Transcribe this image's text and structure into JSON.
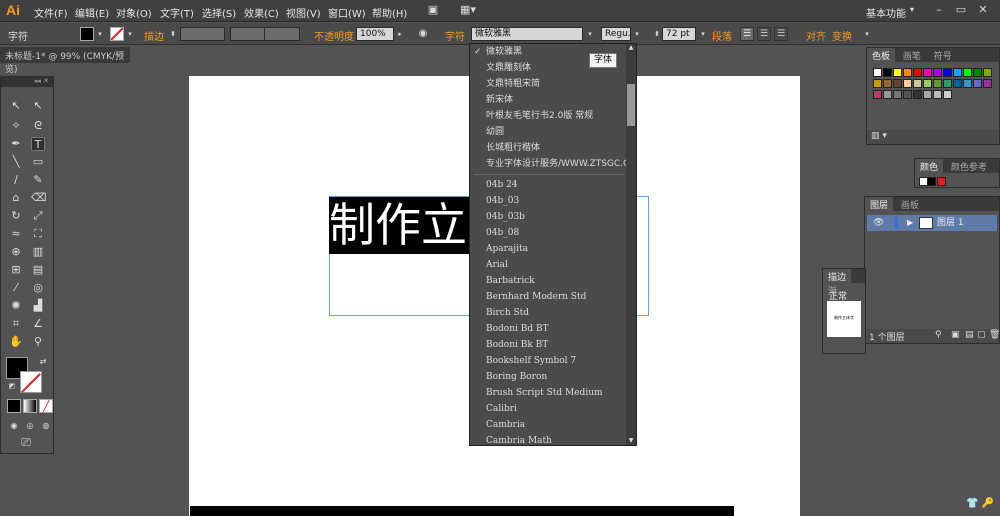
{
  "app": {
    "logo": "Ai"
  },
  "menu": {
    "items": [
      "文件(F)",
      "编辑(E)",
      "对象(O)",
      "文字(T)",
      "选择(S)",
      "效果(C)",
      "视图(V)",
      "窗口(W)",
      "帮助(H)"
    ],
    "workspace": "基本功能"
  },
  "control_bar": {
    "char_label": "字符",
    "stroke_label": "描边",
    "opacity_label": "不透明度",
    "opacity_value": "100%",
    "font_label": "字符",
    "font_value": "微软雅黑",
    "style_value": "Regu...",
    "size_value": "72 pt",
    "paragraph_label": "段落",
    "align_label": "对齐",
    "transform_label": "变换"
  },
  "document": {
    "tab_title": "未标题-1* @ 99% (CMYK/预览)"
  },
  "canvas": {
    "selected_text": "制作立"
  },
  "font_dropdown": {
    "selected": "微软雅黑",
    "chinese_fonts": [
      "微软雅黑",
      "文鼎雕刻体",
      "文鼎特粗宋简",
      "新宋体",
      "叶根友毛笔行书2.0版 常规",
      "幼圆",
      "长城粗行楷体",
      "专业字体设计服务/WWW.ZTSGC.COM/"
    ],
    "latin_fonts": [
      "04b 24",
      "04b_03",
      "04b_03b",
      "04b_08",
      "Aparajita",
      "Arial",
      "Barbatrick",
      "Bernhard Modern Std",
      "Birch Std",
      "Bodoni Bd BT",
      "Bodoni Bk BT",
      "Bookshelf Symbol 7",
      "Boring Boron",
      "Brush Script Std Medium",
      "Calibri",
      "Cambria",
      "Cambria Math"
    ]
  },
  "tooltip": {
    "text": "字体"
  },
  "panels": {
    "swatches": {
      "tabs": [
        "色板",
        "画笔",
        "符号"
      ]
    },
    "color": {
      "tabs": [
        "颜色",
        "颜色参考"
      ]
    },
    "layers": {
      "tabs": [
        "图层",
        "画板"
      ],
      "layer_name": "图层 1",
      "count_label": "1 个图层"
    },
    "stroke": {
      "tabs": [
        "描边",
        "渐"
      ],
      "mode": "正常",
      "thumb_text": "制作立体字"
    }
  },
  "colors": {
    "accent": "#f59a23",
    "selection": "#5e7aa6"
  }
}
